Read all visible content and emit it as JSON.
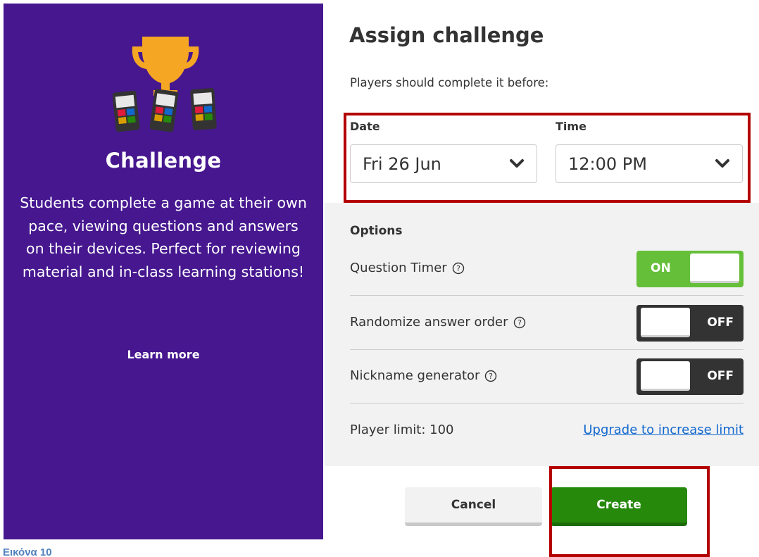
{
  "left_panel": {
    "title": "Challenge",
    "description": "Students complete a game at their own pace, viewing questions and answers on their devices. Perfect for reviewing material and in-class learning stations!",
    "learn_more": "Learn more",
    "illustration_icon": "trophy-with-phones-icon",
    "background": "#46178f"
  },
  "dialog": {
    "title": "Assign challenge",
    "subtitle": "Players should complete it before:",
    "date": {
      "label": "Date",
      "value": "Fri 26 Jun"
    },
    "time": {
      "label": "Time",
      "value": "12:00 PM"
    },
    "options": {
      "heading": "Options",
      "question_timer": {
        "label": "Question Timer",
        "state": "ON"
      },
      "randomize": {
        "label": "Randomize answer order",
        "state": "OFF"
      },
      "nickname": {
        "label": "Nickname generator",
        "state": "OFF"
      },
      "player_limit": "Player limit: 100",
      "upgrade_link": "Upgrade to increase limit"
    },
    "buttons": {
      "cancel": "Cancel",
      "create": "Create"
    }
  },
  "caption": "Εικόνα 10",
  "colors": {
    "toggle_on": "#66bf39",
    "toggle_off": "#333333",
    "create": "#26890c",
    "link": "#1368ce",
    "highlight": "#b30000"
  }
}
